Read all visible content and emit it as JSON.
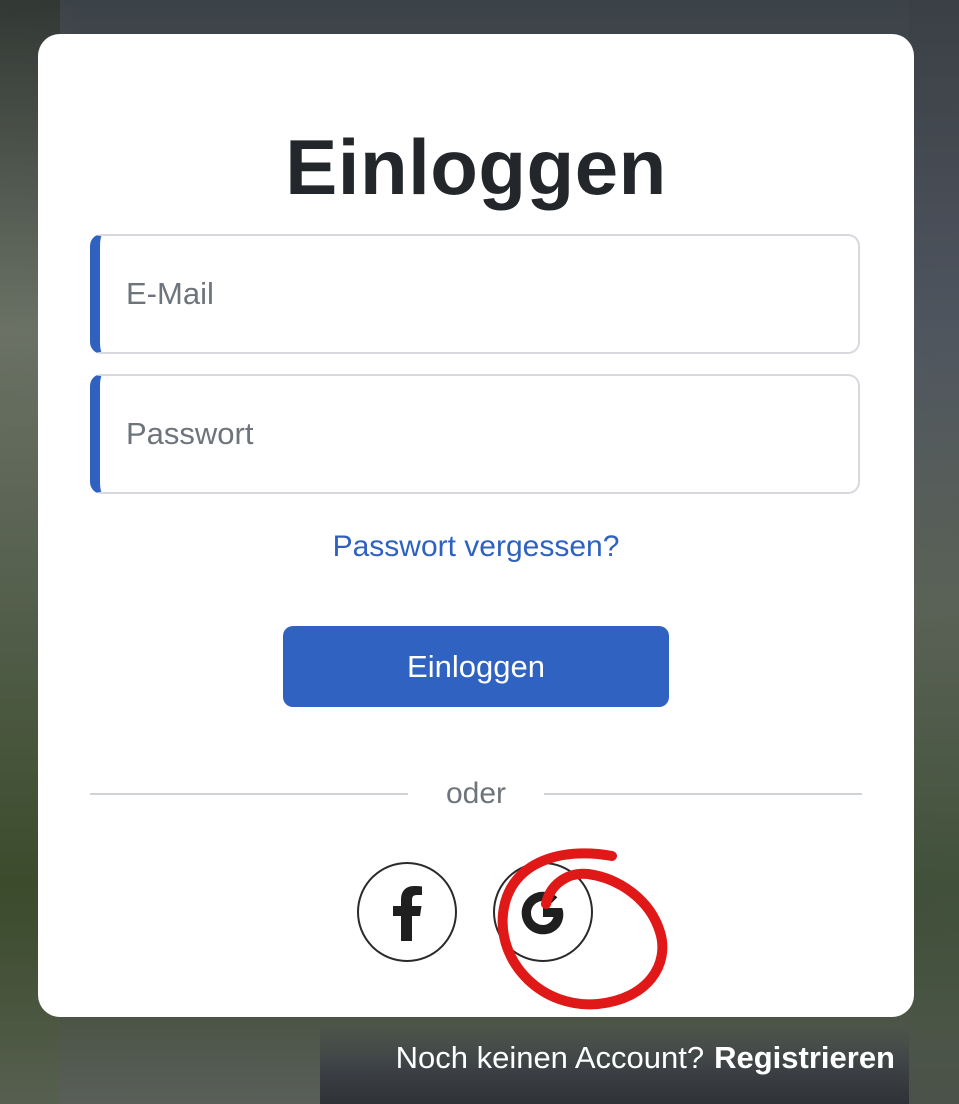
{
  "login": {
    "title": "Einloggen",
    "email_placeholder": "E-Mail",
    "password_placeholder": "Passwort",
    "forgot_password_label": "Passwort vergessen?",
    "submit_label": "Einloggen",
    "divider_text": "oder"
  },
  "social": {
    "items": [
      {
        "icon": "facebook-icon"
      },
      {
        "icon": "google-icon"
      }
    ]
  },
  "footer": {
    "prompt": "Noch keinen Account?",
    "register_label": "Registrieren"
  },
  "colors": {
    "accent": "#2f62c1",
    "annotation": "#e01818",
    "card_background": "#ffffff"
  }
}
